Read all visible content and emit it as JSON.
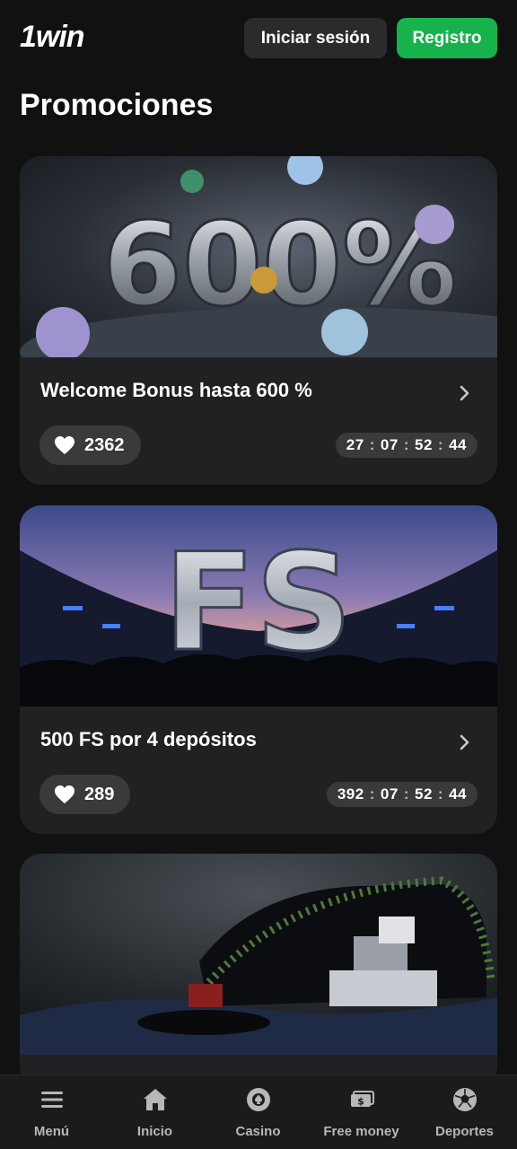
{
  "header": {
    "logo": "1win",
    "login_label": "Iniciar sesión",
    "register_label": "Registro"
  },
  "page": {
    "title": "Promociones"
  },
  "promos": [
    {
      "title": "Welcome Bonus hasta 600 %",
      "likes": "2362",
      "timer": [
        "27",
        "07",
        "52",
        "44"
      ],
      "banner_text": "600%"
    },
    {
      "title": "500 FS por 4 depósitos",
      "likes": "289",
      "timer": [
        "392",
        "07",
        "52",
        "44"
      ],
      "banner_text": "FS"
    },
    {
      "title": ""
    }
  ],
  "nav": [
    {
      "label": "Menú",
      "icon": "menu-icon"
    },
    {
      "label": "Inicio",
      "icon": "home-icon"
    },
    {
      "label": "Casino",
      "icon": "casino-chip-icon"
    },
    {
      "label": "Free money",
      "icon": "money-icon"
    },
    {
      "label": "Deportes",
      "icon": "soccer-ball-icon"
    }
  ],
  "colors": {
    "accent": "#16b24b",
    "card": "#212123",
    "background": "#111112"
  }
}
